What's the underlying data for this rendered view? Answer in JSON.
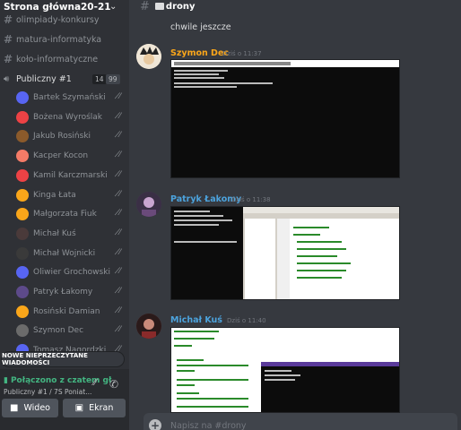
{
  "server": {
    "name": "Strona główna",
    "year": "20-21"
  },
  "channels": [
    {
      "label": "olimpiady-konkursy"
    },
    {
      "label": "matura-informatyka"
    },
    {
      "label": "koło-informatyczne"
    }
  ],
  "voice": {
    "label": "Publiczny #1",
    "count": "14",
    "limit": "99"
  },
  "voice_users": [
    {
      "name": "Bartek Szymański",
      "color": "#5865f2"
    },
    {
      "name": "Bożena Wyroślak",
      "color": "#ed4245"
    },
    {
      "name": "Jakub Rosiński",
      "color": "#8b5a2b"
    },
    {
      "name": "Kacper Kocon",
      "color": "#f47b67"
    },
    {
      "name": "Kamil Karczmarski",
      "color": "#ed4245"
    },
    {
      "name": "Kinga Łata",
      "color": "#faa61a"
    },
    {
      "name": "Małgorzata Fiuk",
      "color": "#faa61a"
    },
    {
      "name": "Michał Kuś",
      "color": "#4a3a3a"
    },
    {
      "name": "Michał Wojnicki",
      "color": "#3a3a3a"
    },
    {
      "name": "Oliwier Grochowski",
      "color": "#5865f2"
    },
    {
      "name": "Patryk Łakomy",
      "color": "#5d4a8a"
    },
    {
      "name": "Rosiński Damian",
      "color": "#faa61a"
    },
    {
      "name": "Szymon Dec",
      "color": "#6b6b6b"
    },
    {
      "name": "Tomasz Nagordzki",
      "color": "#5865f2"
    }
  ],
  "unread_banner": "NOWE NIEPRZECZYTANE WIADOMOŚCI",
  "panel": {
    "connection": "Połączono z czatem gł",
    "location": "Publiczny #1 / 7S Poniat...",
    "video": "Wideo",
    "screen": "Ekran"
  },
  "channel_header": {
    "title": "drony"
  },
  "previous_message": "chwile jeszcze",
  "messages": [
    {
      "author": "Szymon Dec",
      "color": "#faa61a",
      "time": "Dziś o 11:37",
      "avatar_color": "#e8e0d0"
    },
    {
      "author": "Patryk Łakomy",
      "color": "#4ca3dd",
      "time": "Dziś o 11:38",
      "avatar_color": "#4a3a5a"
    },
    {
      "author": "Michał Kuś",
      "color": "#4ca3dd",
      "time": "Dziś o 11:40",
      "avatar_color": "#5a2a2a"
    }
  ],
  "input": {
    "placeholder": "Napisz na #drony"
  },
  "icons": {
    "channel": "hash-icon",
    "voice": "speaker-icon",
    "mute": "mic-off-icon",
    "video": "camera-icon",
    "screen": "screen-share-icon",
    "add": "plus-icon"
  }
}
